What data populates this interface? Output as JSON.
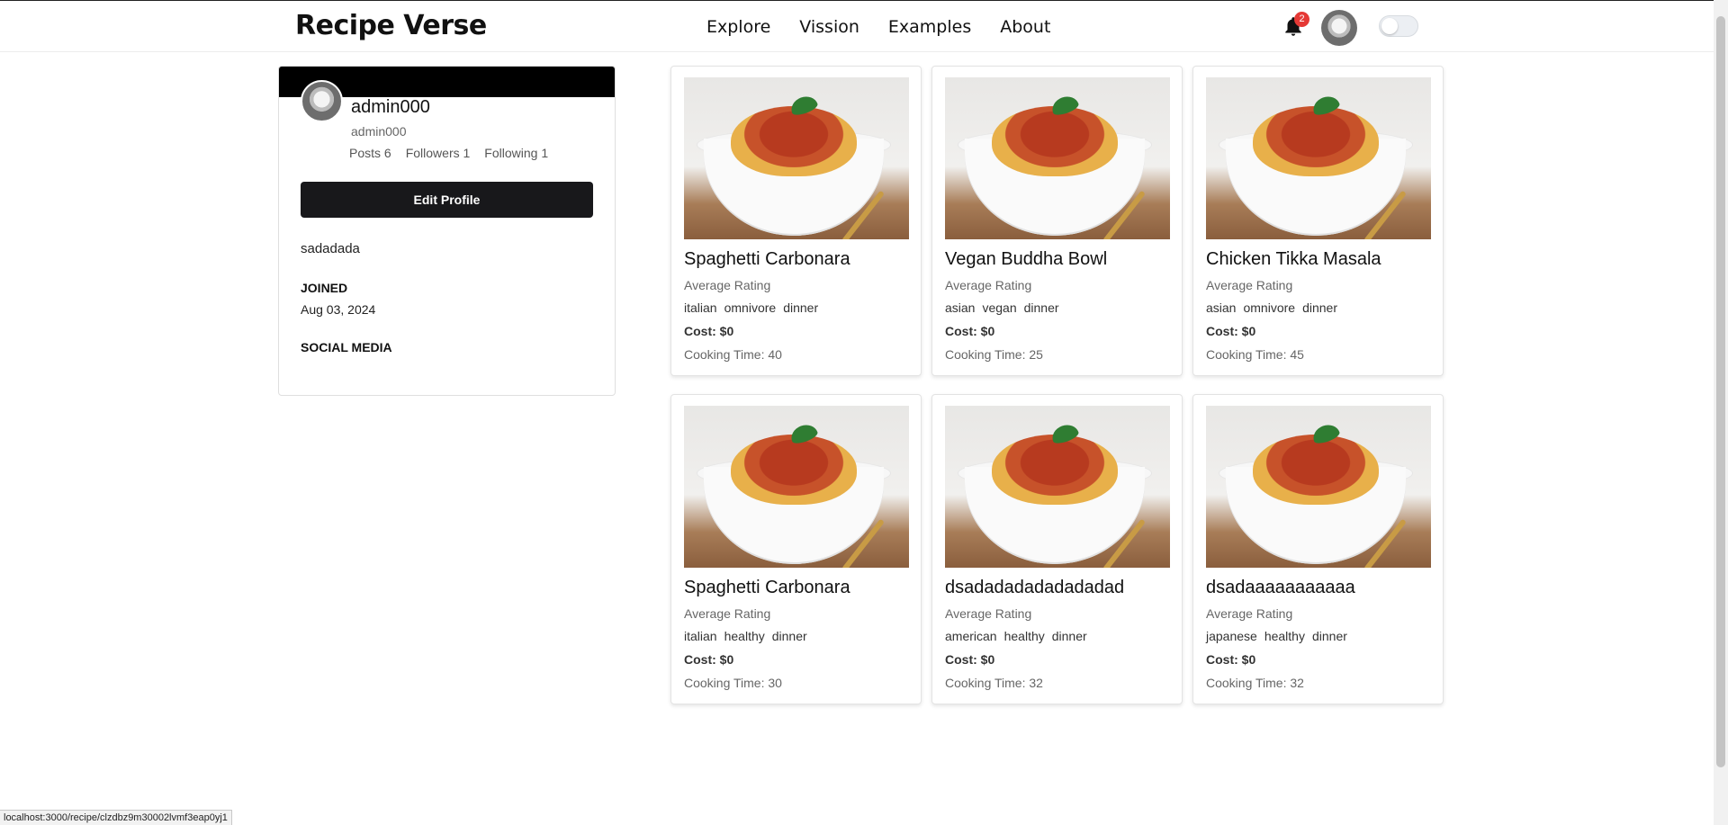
{
  "brand": "Recipe Verse",
  "nav": [
    "Explore",
    "Vission",
    "Examples",
    "About"
  ],
  "notifications": {
    "count": "2"
  },
  "profile": {
    "name": "admin000",
    "username": "admin000",
    "stats": {
      "posts": "Posts 6",
      "followers": "Followers 1",
      "following": "Following 1"
    },
    "edit_label": "Edit Profile",
    "bio": "sadadada",
    "joined_label": "JOINED",
    "joined_date": "Aug 03, 2024",
    "social_label": "SOCIAL MEDIA"
  },
  "recipes": [
    {
      "title": "Spaghetti Carbonara",
      "rating_label": "Average Rating",
      "tags": [
        "italian",
        "omnivore",
        "dinner"
      ],
      "cost": "Cost: $0",
      "time": "Cooking Time: 40"
    },
    {
      "title": "Vegan Buddha Bowl",
      "rating_label": "Average Rating",
      "tags": [
        "asian",
        "vegan",
        "dinner"
      ],
      "cost": "Cost: $0",
      "time": "Cooking Time: 25"
    },
    {
      "title": "Chicken Tikka Masala",
      "rating_label": "Average Rating",
      "tags": [
        "asian",
        "omnivore",
        "dinner"
      ],
      "cost": "Cost: $0",
      "time": "Cooking Time: 45"
    },
    {
      "title": "Spaghetti Carbonara",
      "rating_label": "Average Rating",
      "tags": [
        "italian",
        "healthy",
        "dinner"
      ],
      "cost": "Cost: $0",
      "time": "Cooking Time: 30"
    },
    {
      "title": "dsadadadadadadadad",
      "rating_label": "Average Rating",
      "tags": [
        "american",
        "healthy",
        "dinner"
      ],
      "cost": "Cost: $0",
      "time": "Cooking Time: 32"
    },
    {
      "title": "dsadaaaaaaaaaaa",
      "rating_label": "Average Rating",
      "tags": [
        "japanese",
        "healthy",
        "dinner"
      ],
      "cost": "Cost: $0",
      "time": "Cooking Time: 32"
    }
  ],
  "status_url": "localhost:3000/recipe/clzdbz9m30002lvmf3eap0yj1",
  "colors": {
    "badge": "#e53935",
    "button": "#18181b",
    "banner": "#000000"
  }
}
